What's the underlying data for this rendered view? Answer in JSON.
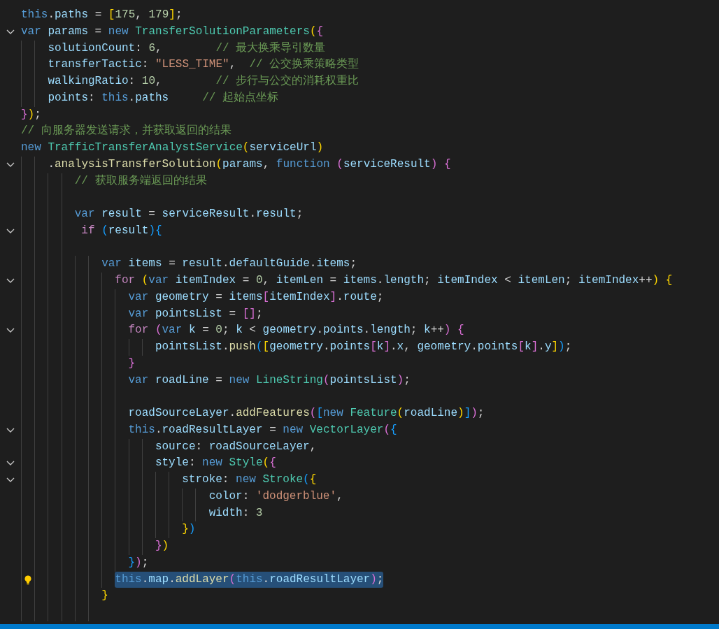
{
  "lines": [
    {
      "foldable": false,
      "lightbulb": false,
      "selected": false,
      "tokens": [
        {
          "kind": "kw",
          "text": "this"
        },
        {
          "kind": "pun",
          "text": "."
        },
        {
          "kind": "var",
          "text": "paths"
        },
        {
          "kind": "pun",
          "text": " = "
        },
        {
          "kind": "br1",
          "text": "["
        },
        {
          "kind": "num",
          "text": "175"
        },
        {
          "kind": "pun",
          "text": ", "
        },
        {
          "kind": "num",
          "text": "179"
        },
        {
          "kind": "br1",
          "text": "]"
        },
        {
          "kind": "pun",
          "text": ";"
        }
      ]
    },
    {
      "foldable": true,
      "lightbulb": false,
      "selected": false,
      "tokens": [
        {
          "kind": "kw",
          "text": "var "
        },
        {
          "kind": "var",
          "text": "params"
        },
        {
          "kind": "pun",
          "text": " = "
        },
        {
          "kind": "kw",
          "text": "new "
        },
        {
          "kind": "cls",
          "text": "TransferSolutionParameters"
        },
        {
          "kind": "br1",
          "text": "("
        },
        {
          "kind": "br2",
          "text": "{"
        }
      ]
    },
    {
      "foldable": false,
      "lightbulb": false,
      "selected": false,
      "tokens": [
        {
          "kind": "var",
          "text": "    solutionCount"
        },
        {
          "kind": "pun",
          "text": ": "
        },
        {
          "kind": "num",
          "text": "6"
        },
        {
          "kind": "pun",
          "text": ",        "
        },
        {
          "kind": "com",
          "text": "// 最大换乘导引数量"
        }
      ]
    },
    {
      "foldable": false,
      "lightbulb": false,
      "selected": false,
      "tokens": [
        {
          "kind": "var",
          "text": "    transferTactic"
        },
        {
          "kind": "pun",
          "text": ": "
        },
        {
          "kind": "str",
          "text": "\"LESS_TIME\""
        },
        {
          "kind": "pun",
          "text": ",  "
        },
        {
          "kind": "com",
          "text": "// 公交换乘策略类型"
        }
      ]
    },
    {
      "foldable": false,
      "lightbulb": false,
      "selected": false,
      "tokens": [
        {
          "kind": "var",
          "text": "    walkingRatio"
        },
        {
          "kind": "pun",
          "text": ": "
        },
        {
          "kind": "num",
          "text": "10"
        },
        {
          "kind": "pun",
          "text": ",        "
        },
        {
          "kind": "com",
          "text": "// 步行与公交的消耗权重比"
        }
      ]
    },
    {
      "foldable": false,
      "lightbulb": false,
      "selected": false,
      "tokens": [
        {
          "kind": "var",
          "text": "    points"
        },
        {
          "kind": "pun",
          "text": ": "
        },
        {
          "kind": "kw",
          "text": "this"
        },
        {
          "kind": "pun",
          "text": "."
        },
        {
          "kind": "var",
          "text": "paths     "
        },
        {
          "kind": "com",
          "text": "// 起始点坐标"
        }
      ]
    },
    {
      "foldable": false,
      "lightbulb": false,
      "selected": false,
      "tokens": [
        {
          "kind": "br2",
          "text": "}"
        },
        {
          "kind": "br1",
          "text": ")"
        },
        {
          "kind": "pun",
          "text": ";"
        }
      ]
    },
    {
      "foldable": false,
      "lightbulb": false,
      "selected": false,
      "tokens": [
        {
          "kind": "com",
          "text": "// 向服务器发送请求，并获取返回的结果"
        }
      ]
    },
    {
      "foldable": false,
      "lightbulb": false,
      "selected": false,
      "tokens": [
        {
          "kind": "kw",
          "text": "new "
        },
        {
          "kind": "cls",
          "text": "TrafficTransferAnalystService"
        },
        {
          "kind": "br1",
          "text": "("
        },
        {
          "kind": "var",
          "text": "serviceUrl"
        },
        {
          "kind": "br1",
          "text": ")"
        }
      ]
    },
    {
      "foldable": true,
      "lightbulb": false,
      "selected": false,
      "tokens": [
        {
          "kind": "pun",
          "text": "    ."
        },
        {
          "kind": "fn",
          "text": "analysisTransferSolution"
        },
        {
          "kind": "br1",
          "text": "("
        },
        {
          "kind": "var",
          "text": "params"
        },
        {
          "kind": "pun",
          "text": ", "
        },
        {
          "kind": "kw",
          "text": "function "
        },
        {
          "kind": "br2",
          "text": "("
        },
        {
          "kind": "var",
          "text": "serviceResult"
        },
        {
          "kind": "br2",
          "text": ")"
        },
        {
          "kind": "br2",
          "text": " {"
        }
      ]
    },
    {
      "foldable": false,
      "lightbulb": false,
      "selected": false,
      "tokens": [
        {
          "kind": "com",
          "text": "        // 获取服务端返回的结果"
        }
      ]
    },
    {
      "foldable": false,
      "lightbulb": false,
      "selected": false
    },
    {
      "foldable": false,
      "lightbulb": false,
      "selected": false,
      "tokens": [
        {
          "kind": "kw",
          "text": "        var "
        },
        {
          "kind": "var",
          "text": "result"
        },
        {
          "kind": "pun",
          "text": " = "
        },
        {
          "kind": "var",
          "text": "serviceResult"
        },
        {
          "kind": "pun",
          "text": "."
        },
        {
          "kind": "var",
          "text": "result"
        },
        {
          "kind": "pun",
          "text": ";"
        }
      ]
    },
    {
      "foldable": true,
      "lightbulb": false,
      "selected": false,
      "tokens": [
        {
          "kind": "ctl",
          "text": "         if "
        },
        {
          "kind": "br3",
          "text": "("
        },
        {
          "kind": "var",
          "text": "result"
        },
        {
          "kind": "br3",
          "text": ")"
        },
        {
          "kind": "br3",
          "text": "{"
        }
      ]
    },
    {
      "foldable": false,
      "lightbulb": false,
      "selected": false
    },
    {
      "foldable": false,
      "lightbulb": false,
      "selected": false,
      "tokens": [
        {
          "kind": "kw",
          "text": "            var "
        },
        {
          "kind": "var",
          "text": "items"
        },
        {
          "kind": "pun",
          "text": " = "
        },
        {
          "kind": "var",
          "text": "result"
        },
        {
          "kind": "pun",
          "text": "."
        },
        {
          "kind": "var",
          "text": "defaultGuide"
        },
        {
          "kind": "pun",
          "text": "."
        },
        {
          "kind": "var",
          "text": "items"
        },
        {
          "kind": "pun",
          "text": ";"
        }
      ]
    },
    {
      "foldable": true,
      "lightbulb": false,
      "selected": false,
      "tokens": [
        {
          "kind": "ctl",
          "text": "              for "
        },
        {
          "kind": "br1",
          "text": "("
        },
        {
          "kind": "kw",
          "text": "var "
        },
        {
          "kind": "var",
          "text": "itemIndex"
        },
        {
          "kind": "pun",
          "text": " = "
        },
        {
          "kind": "num",
          "text": "0"
        },
        {
          "kind": "pun",
          "text": ", "
        },
        {
          "kind": "var",
          "text": "itemLen"
        },
        {
          "kind": "pun",
          "text": " = "
        },
        {
          "kind": "var",
          "text": "items"
        },
        {
          "kind": "pun",
          "text": "."
        },
        {
          "kind": "var",
          "text": "length"
        },
        {
          "kind": "pun",
          "text": "; "
        },
        {
          "kind": "var",
          "text": "itemIndex"
        },
        {
          "kind": "pun",
          "text": " < "
        },
        {
          "kind": "var",
          "text": "itemLen"
        },
        {
          "kind": "pun",
          "text": "; "
        },
        {
          "kind": "var",
          "text": "itemIndex"
        },
        {
          "kind": "pun",
          "text": "++"
        },
        {
          "kind": "br1",
          "text": ")"
        },
        {
          "kind": "br1",
          "text": " {"
        }
      ]
    },
    {
      "foldable": false,
      "lightbulb": false,
      "selected": false,
      "tokens": [
        {
          "kind": "kw",
          "text": "                var "
        },
        {
          "kind": "var",
          "text": "geometry"
        },
        {
          "kind": "pun",
          "text": " = "
        },
        {
          "kind": "var",
          "text": "items"
        },
        {
          "kind": "br2",
          "text": "["
        },
        {
          "kind": "var",
          "text": "itemIndex"
        },
        {
          "kind": "br2",
          "text": "]"
        },
        {
          "kind": "pun",
          "text": "."
        },
        {
          "kind": "var",
          "text": "route"
        },
        {
          "kind": "pun",
          "text": ";"
        }
      ]
    },
    {
      "foldable": false,
      "lightbulb": false,
      "selected": false,
      "tokens": [
        {
          "kind": "kw",
          "text": "                var "
        },
        {
          "kind": "var",
          "text": "pointsList"
        },
        {
          "kind": "pun",
          "text": " = "
        },
        {
          "kind": "br2",
          "text": "[]"
        },
        {
          "kind": "pun",
          "text": ";"
        }
      ]
    },
    {
      "foldable": true,
      "lightbulb": false,
      "selected": false,
      "tokens": [
        {
          "kind": "ctl",
          "text": "                for "
        },
        {
          "kind": "br2",
          "text": "("
        },
        {
          "kind": "kw",
          "text": "var "
        },
        {
          "kind": "var",
          "text": "k"
        },
        {
          "kind": "pun",
          "text": " = "
        },
        {
          "kind": "num",
          "text": "0"
        },
        {
          "kind": "pun",
          "text": "; "
        },
        {
          "kind": "var",
          "text": "k"
        },
        {
          "kind": "pun",
          "text": " < "
        },
        {
          "kind": "var",
          "text": "geometry"
        },
        {
          "kind": "pun",
          "text": "."
        },
        {
          "kind": "var",
          "text": "points"
        },
        {
          "kind": "pun",
          "text": "."
        },
        {
          "kind": "var",
          "text": "length"
        },
        {
          "kind": "pun",
          "text": "; "
        },
        {
          "kind": "var",
          "text": "k"
        },
        {
          "kind": "pun",
          "text": "++"
        },
        {
          "kind": "br2",
          "text": ")"
        },
        {
          "kind": "br2",
          "text": " {"
        }
      ]
    },
    {
      "foldable": false,
      "lightbulb": false,
      "selected": false,
      "tokens": [
        {
          "kind": "var",
          "text": "                    pointsList"
        },
        {
          "kind": "pun",
          "text": "."
        },
        {
          "kind": "fn",
          "text": "push"
        },
        {
          "kind": "br3",
          "text": "("
        },
        {
          "kind": "br1",
          "text": "["
        },
        {
          "kind": "var",
          "text": "geometry"
        },
        {
          "kind": "pun",
          "text": "."
        },
        {
          "kind": "var",
          "text": "points"
        },
        {
          "kind": "br2",
          "text": "["
        },
        {
          "kind": "var",
          "text": "k"
        },
        {
          "kind": "br2",
          "text": "]"
        },
        {
          "kind": "pun",
          "text": "."
        },
        {
          "kind": "var",
          "text": "x"
        },
        {
          "kind": "pun",
          "text": ", "
        },
        {
          "kind": "var",
          "text": "geometry"
        },
        {
          "kind": "pun",
          "text": "."
        },
        {
          "kind": "var",
          "text": "points"
        },
        {
          "kind": "br2",
          "text": "["
        },
        {
          "kind": "var",
          "text": "k"
        },
        {
          "kind": "br2",
          "text": "]"
        },
        {
          "kind": "pun",
          "text": "."
        },
        {
          "kind": "var",
          "text": "y"
        },
        {
          "kind": "br1",
          "text": "]"
        },
        {
          "kind": "br3",
          "text": ")"
        },
        {
          "kind": "pun",
          "text": ";"
        }
      ]
    },
    {
      "foldable": false,
      "lightbulb": false,
      "selected": false,
      "tokens": [
        {
          "kind": "br2",
          "text": "                }"
        }
      ]
    },
    {
      "foldable": false,
      "lightbulb": false,
      "selected": false,
      "tokens": [
        {
          "kind": "kw",
          "text": "                var "
        },
        {
          "kind": "var",
          "text": "roadLine"
        },
        {
          "kind": "pun",
          "text": " = "
        },
        {
          "kind": "kw",
          "text": "new "
        },
        {
          "kind": "cls",
          "text": "LineString"
        },
        {
          "kind": "br2",
          "text": "("
        },
        {
          "kind": "var",
          "text": "pointsList"
        },
        {
          "kind": "br2",
          "text": ")"
        },
        {
          "kind": "pun",
          "text": ";"
        }
      ]
    },
    {
      "foldable": false,
      "lightbulb": false,
      "selected": false
    },
    {
      "foldable": false,
      "lightbulb": false,
      "selected": false,
      "tokens": [
        {
          "kind": "var",
          "text": "                roadSourceLayer"
        },
        {
          "kind": "pun",
          "text": "."
        },
        {
          "kind": "fn",
          "text": "addFeatures"
        },
        {
          "kind": "br2",
          "text": "("
        },
        {
          "kind": "br3",
          "text": "["
        },
        {
          "kind": "kw",
          "text": "new "
        },
        {
          "kind": "cls",
          "text": "Feature"
        },
        {
          "kind": "br1",
          "text": "("
        },
        {
          "kind": "var",
          "text": "roadLine"
        },
        {
          "kind": "br1",
          "text": ")"
        },
        {
          "kind": "br3",
          "text": "]"
        },
        {
          "kind": "br2",
          "text": ")"
        },
        {
          "kind": "pun",
          "text": ";"
        }
      ]
    },
    {
      "foldable": true,
      "lightbulb": false,
      "selected": false,
      "tokens": [
        {
          "kind": "kw",
          "text": "                this"
        },
        {
          "kind": "pun",
          "text": "."
        },
        {
          "kind": "var",
          "text": "roadResultLayer"
        },
        {
          "kind": "pun",
          "text": " = "
        },
        {
          "kind": "kw",
          "text": "new "
        },
        {
          "kind": "cls",
          "text": "VectorLayer"
        },
        {
          "kind": "br2",
          "text": "("
        },
        {
          "kind": "br3",
          "text": "{"
        }
      ]
    },
    {
      "foldable": false,
      "lightbulb": false,
      "selected": false,
      "tokens": [
        {
          "kind": "var",
          "text": "                    source"
        },
        {
          "kind": "pun",
          "text": ": "
        },
        {
          "kind": "var",
          "text": "roadSourceLayer"
        },
        {
          "kind": "pun",
          "text": ","
        }
      ]
    },
    {
      "foldable": true,
      "lightbulb": false,
      "selected": false,
      "tokens": [
        {
          "kind": "var",
          "text": "                    style"
        },
        {
          "kind": "pun",
          "text": ": "
        },
        {
          "kind": "kw",
          "text": "new "
        },
        {
          "kind": "cls",
          "text": "Style"
        },
        {
          "kind": "br1",
          "text": "("
        },
        {
          "kind": "br2",
          "text": "{"
        }
      ]
    },
    {
      "foldable": true,
      "lightbulb": false,
      "selected": false,
      "tokens": [
        {
          "kind": "var",
          "text": "                        stroke"
        },
        {
          "kind": "pun",
          "text": ": "
        },
        {
          "kind": "kw",
          "text": "new "
        },
        {
          "kind": "cls",
          "text": "Stroke"
        },
        {
          "kind": "br3",
          "text": "("
        },
        {
          "kind": "br1",
          "text": "{"
        }
      ]
    },
    {
      "foldable": false,
      "lightbulb": false,
      "selected": false,
      "tokens": [
        {
          "kind": "var",
          "text": "                            color"
        },
        {
          "kind": "pun",
          "text": ": "
        },
        {
          "kind": "str",
          "text": "'dodgerblue'"
        },
        {
          "kind": "pun",
          "text": ","
        }
      ]
    },
    {
      "foldable": false,
      "lightbulb": false,
      "selected": false,
      "tokens": [
        {
          "kind": "var",
          "text": "                            width"
        },
        {
          "kind": "pun",
          "text": ": "
        },
        {
          "kind": "num",
          "text": "3"
        }
      ]
    },
    {
      "foldable": false,
      "lightbulb": false,
      "selected": false,
      "tokens": [
        {
          "kind": "br1",
          "text": "                        }"
        },
        {
          "kind": "br3",
          "text": ")"
        }
      ]
    },
    {
      "foldable": false,
      "lightbulb": false,
      "selected": false,
      "tokens": [
        {
          "kind": "br2",
          "text": "                    }"
        },
        {
          "kind": "br1",
          "text": ")"
        }
      ]
    },
    {
      "foldable": false,
      "lightbulb": false,
      "selected": false,
      "tokens": [
        {
          "kind": "br3",
          "text": "                }"
        },
        {
          "kind": "br2",
          "text": ")"
        },
        {
          "kind": "pun",
          "text": ";"
        }
      ]
    },
    {
      "foldable": false,
      "lightbulb": true,
      "selected": true,
      "tokens": [
        {
          "kind": "kw",
          "text": "              this"
        },
        {
          "kind": "pun",
          "text": "."
        },
        {
          "kind": "var",
          "text": "map"
        },
        {
          "kind": "pun",
          "text": "."
        },
        {
          "kind": "fn",
          "text": "addLayer"
        },
        {
          "kind": "br2",
          "text": "("
        },
        {
          "kind": "kw",
          "text": "this"
        },
        {
          "kind": "pun",
          "text": "."
        },
        {
          "kind": "var",
          "text": "roadResultLayer"
        },
        {
          "kind": "br2",
          "text": ")"
        },
        {
          "kind": "pun",
          "text": ";"
        }
      ]
    },
    {
      "foldable": false,
      "lightbulb": false,
      "selected": false,
      "tokens": [
        {
          "kind": "br1",
          "text": "            }"
        }
      ]
    },
    {
      "foldable": false,
      "lightbulb": false,
      "selected": false
    }
  ]
}
